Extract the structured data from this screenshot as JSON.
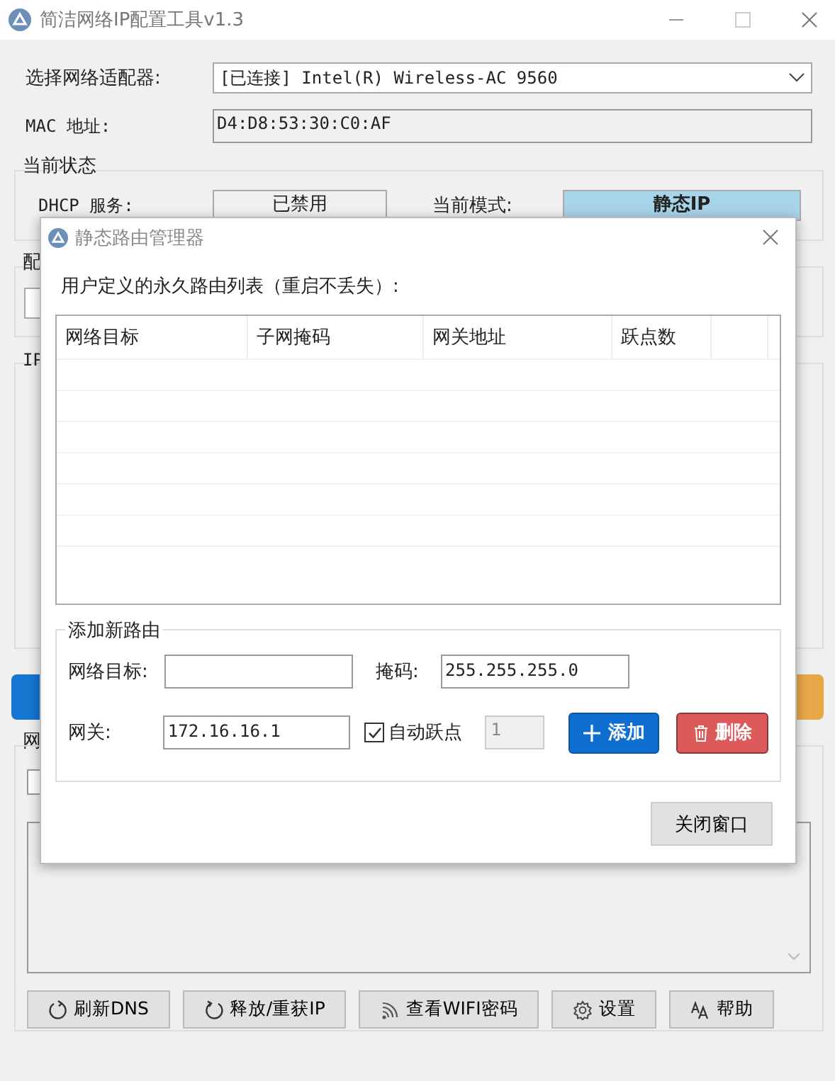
{
  "window": {
    "title": "简洁网络IP配置工具v1.3"
  },
  "adapter": {
    "label": "选择网络适配器:",
    "value": "[已连接] Intel(R) Wireless-AC 9560"
  },
  "mac": {
    "label": "MAC 地址:",
    "value": "D4:D8:53:30:C0:AF"
  },
  "status": {
    "title": "当前状态",
    "dhcp_label": "DHCP 服务:",
    "dhcp_value": "已禁用",
    "mode_label": "当前模式:",
    "mode_value": "静态IP"
  },
  "config_group": {
    "title": "配"
  },
  "ip_group": {
    "title": "IP"
  },
  "action_buttons": [
    {
      "color": "#1677d2"
    },
    {
      "color": "#e8a84a"
    }
  ],
  "network_group": {
    "title": "网",
    "checked": false
  },
  "bottom_buttons": [
    {
      "label": "刷新DNS",
      "kind": "refresh"
    },
    {
      "label": "释放/重获IP",
      "kind": "release"
    },
    {
      "label": "查看WIFI密码",
      "kind": "wifi"
    },
    {
      "label": "设置",
      "kind": "settings"
    },
    {
      "label": "帮助",
      "kind": "help"
    }
  ],
  "dialog": {
    "title": "静态路由管理器",
    "list_label": "用户定义的永久路由列表（重启不丢失）:",
    "table": {
      "columns": [
        "网络目标",
        "子网掩码",
        "网关地址",
        "跃点数"
      ]
    },
    "add_group": {
      "title": "添加新路由",
      "target_label": "网络目标:",
      "mask_label": "掩码:",
      "mask_value": "255.255.255.0",
      "gateway_label": "网关:",
      "gateway_value": "172.16.16.1",
      "auto_hop": {
        "label": "自动跃点",
        "checked": true
      },
      "hop_value": "1",
      "hop_disabled": true,
      "add_button": "添加",
      "delete_button": "删除"
    },
    "close_button": "关闭窗口"
  }
}
